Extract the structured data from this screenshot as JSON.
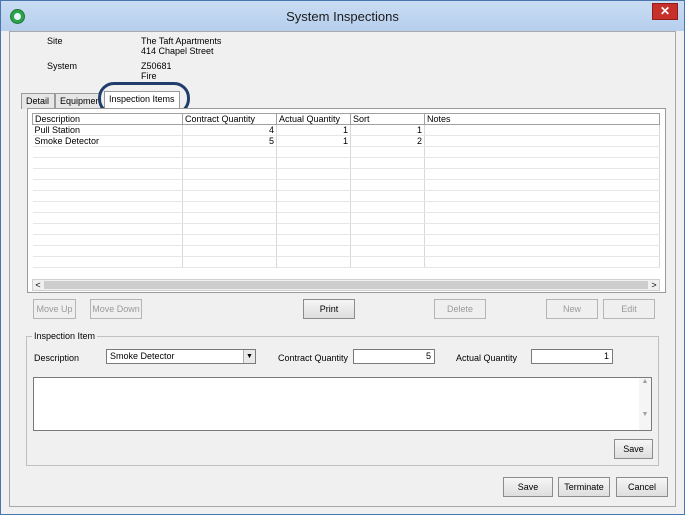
{
  "window": {
    "title": "System Inspections",
    "close_glyph": "✕"
  },
  "site": {
    "label": "Site",
    "name": "The Taft Apartments",
    "address": "414 Chapel Street"
  },
  "system": {
    "label": "System",
    "code": "Z50681",
    "type": "Fire"
  },
  "tabs": [
    {
      "label": "Detail",
      "active": false
    },
    {
      "label": "Equipment",
      "active": false
    },
    {
      "label": "Inspection Items",
      "active": true
    }
  ],
  "grid": {
    "columns": [
      "Description",
      "Contract Quantity",
      "Actual Quantity",
      "Sort",
      "Notes"
    ],
    "rows": [
      {
        "description": "Pull Station",
        "contract_qty": "4",
        "actual_qty": "1",
        "sort": "1",
        "notes": ""
      },
      {
        "description": "Smoke Detector",
        "contract_qty": "5",
        "actual_qty": "1",
        "sort": "2",
        "notes": ""
      }
    ],
    "scroll_left": "<",
    "scroll_right": ">"
  },
  "buttons": {
    "move_up": "Move Up",
    "move_down": "Move Down",
    "print": "Print",
    "delete": "Delete",
    "new": "New",
    "edit": "Edit",
    "item_save": "Save",
    "save": "Save",
    "terminate": "Terminate",
    "cancel": "Cancel"
  },
  "inspection_item": {
    "group_label": "Inspection Item",
    "description_label": "Description",
    "description_value": "Smoke Detector",
    "contract_qty_label": "Contract Quantity",
    "contract_qty_value": "5",
    "actual_qty_label": "Actual Quantity",
    "actual_qty_value": "1",
    "notes_value": ""
  },
  "colors": {
    "title_bar": "#c9dcf2",
    "close_button": "#c7312a",
    "highlight": "#1f3e6b"
  }
}
